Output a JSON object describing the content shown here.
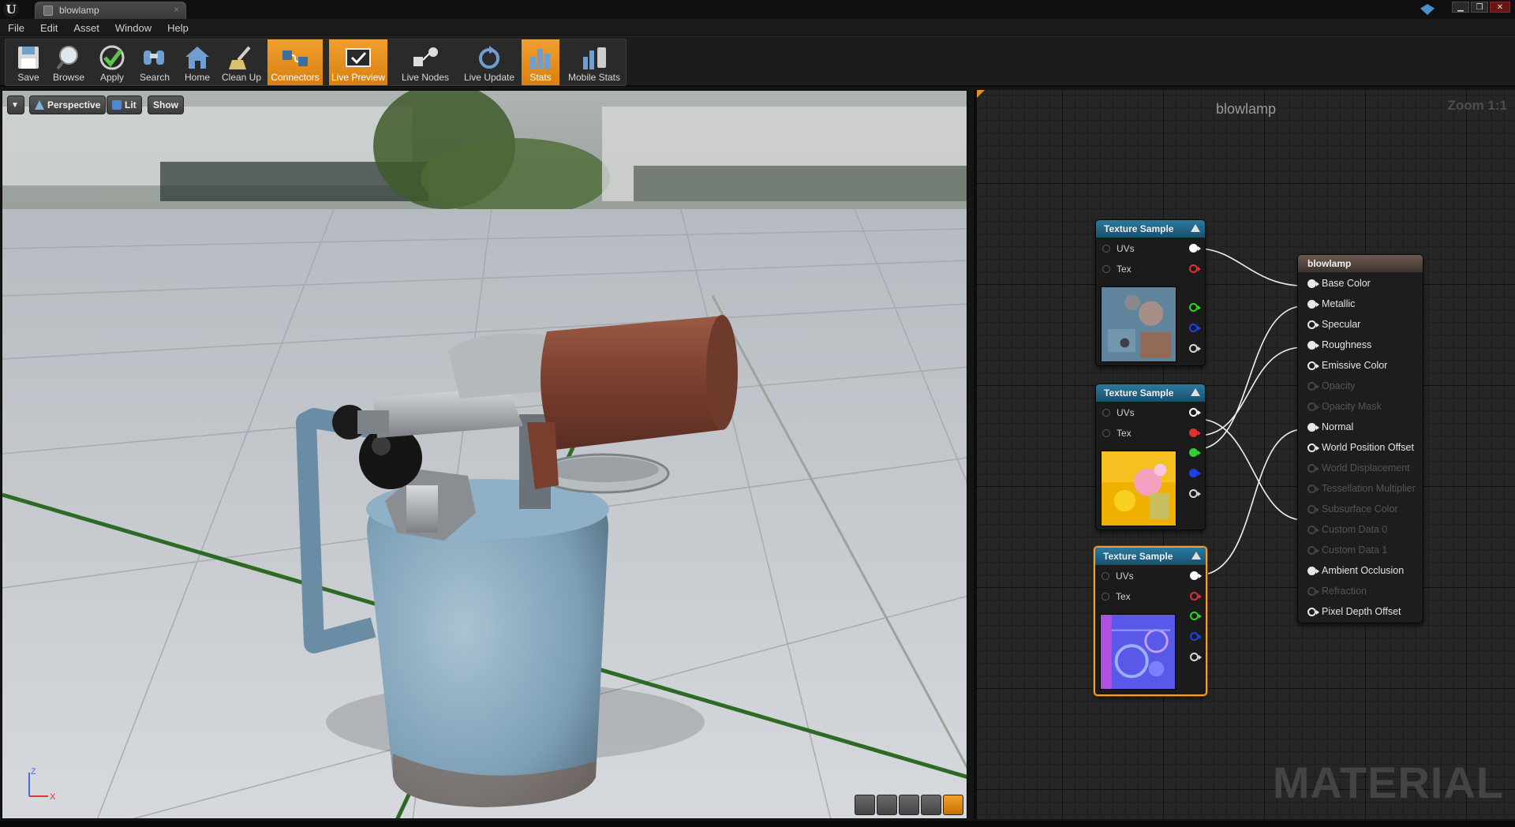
{
  "window": {
    "tab_title": "blowlamp",
    "tab_close": "×",
    "controls": {
      "minimize": "▁",
      "maximize": "❐",
      "close": "✕"
    }
  },
  "menu": [
    "File",
    "Edit",
    "Asset",
    "Window",
    "Help"
  ],
  "toolbar": {
    "buttons": [
      {
        "id": "save",
        "label": "Save",
        "icon": "save-icon",
        "active": false
      },
      {
        "id": "browse",
        "label": "Browse",
        "icon": "browse-icon",
        "active": false
      },
      {
        "id": "apply",
        "label": "Apply",
        "icon": "apply-icon",
        "active": false
      },
      {
        "id": "search",
        "label": "Search",
        "icon": "search-icon",
        "active": false
      },
      {
        "id": "home",
        "label": "Home",
        "icon": "home-icon",
        "active": false
      },
      {
        "id": "cleanup",
        "label": "Clean Up",
        "icon": "clean-up-icon",
        "active": false
      },
      {
        "id": "connectors",
        "label": "Connectors",
        "icon": "connectors-icon",
        "active": true
      },
      {
        "id": "livepreview",
        "label": "Live Preview",
        "icon": "live-preview-icon",
        "active": true
      },
      {
        "id": "livenodes",
        "label": "Live Nodes",
        "icon": "live-nodes-icon",
        "active": false
      },
      {
        "id": "liveupdate",
        "label": "Live Update",
        "icon": "live-update-icon",
        "active": false
      },
      {
        "id": "stats",
        "label": "Stats",
        "icon": "stats-icon",
        "active": true
      },
      {
        "id": "mobilestats",
        "label": "Mobile Stats",
        "icon": "mobile-stats-icon",
        "active": false
      }
    ]
  },
  "viewport": {
    "perspective_label": "Perspective",
    "lit_label": "Lit",
    "show_label": "Show",
    "axis": {
      "z": "Z",
      "x": "X"
    }
  },
  "graph": {
    "title": "blowlamp",
    "zoom": "Zoom 1:1",
    "watermark": "MATERIAL",
    "texture_nodes": [
      {
        "title": "Texture Sample",
        "inputs": [
          "UVs",
          "Tex"
        ],
        "preview": "base-color-texture",
        "selected": false
      },
      {
        "title": "Texture Sample",
        "inputs": [
          "UVs",
          "Tex"
        ],
        "preview": "orm-texture",
        "selected": false
      },
      {
        "title": "Texture Sample",
        "inputs": [
          "UVs",
          "Tex"
        ],
        "preview": "normal-texture",
        "selected": true
      }
    ],
    "output_pin_colors": [
      "#ffffff",
      "#e03030",
      "#30d030",
      "#2040e0",
      "#d8d8d8"
    ],
    "result_node": {
      "title": "blowlamp",
      "pins": [
        {
          "label": "Base Color",
          "enabled": true,
          "connected": true
        },
        {
          "label": "Metallic",
          "enabled": true,
          "connected": true
        },
        {
          "label": "Specular",
          "enabled": true,
          "connected": false
        },
        {
          "label": "Roughness",
          "enabled": true,
          "connected": true
        },
        {
          "label": "Emissive Color",
          "enabled": true,
          "connected": false
        },
        {
          "label": "Opacity",
          "enabled": false,
          "connected": false
        },
        {
          "label": "Opacity Mask",
          "enabled": false,
          "connected": false
        },
        {
          "label": "Normal",
          "enabled": true,
          "connected": true
        },
        {
          "label": "World Position Offset",
          "enabled": true,
          "connected": false
        },
        {
          "label": "World Displacement",
          "enabled": false,
          "connected": false
        },
        {
          "label": "Tessellation Multiplier",
          "enabled": false,
          "connected": false
        },
        {
          "label": "Subsurface Color",
          "enabled": false,
          "connected": false
        },
        {
          "label": "Custom Data 0",
          "enabled": false,
          "connected": false
        },
        {
          "label": "Custom Data 1",
          "enabled": false,
          "connected": false
        },
        {
          "label": "Ambient Occlusion",
          "enabled": true,
          "connected": true
        },
        {
          "label": "Refraction",
          "enabled": false,
          "connected": false
        },
        {
          "label": "Pixel Depth Offset",
          "enabled": true,
          "connected": false
        }
      ]
    }
  },
  "colors": {
    "accent": "#f0a030",
    "node_header": "#2b7aa0",
    "result_header": "#6b5a50"
  }
}
